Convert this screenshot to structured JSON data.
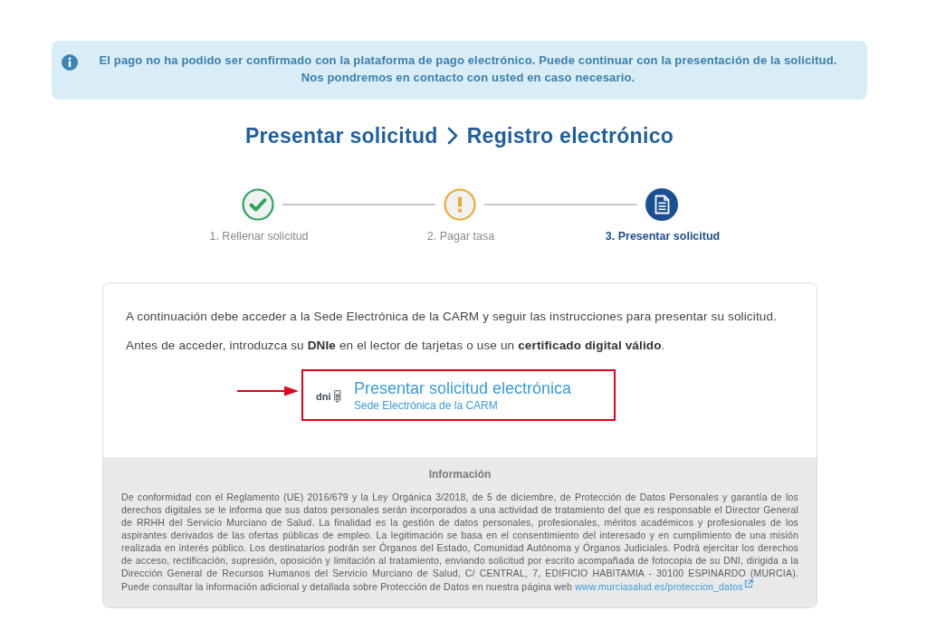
{
  "alert": {
    "lines": [
      "El pago no ha podido ser confirmado con la plataforma de pago electrónico. Puede continuar con la presentación de la solicitud.",
      "Nos pondremos en contacto con usted en caso necesario."
    ]
  },
  "breadcrumb": [
    {
      "label": "Presentar solicitud"
    },
    {
      "label": "Registro electrónico"
    }
  ],
  "steps": [
    {
      "label": "1. Rellenar solicitud",
      "kind": "done",
      "selected": false
    },
    {
      "label": "2. Pagar tasa",
      "kind": "warning",
      "selected": false
    },
    {
      "label": "3. Presentar solicitud",
      "kind": "document",
      "selected": true
    }
  ],
  "instructions": {
    "intro": "A continuación debe acceder a la Sede Electrónica de la CARM y seguir las instrucciones para presentar su solicitud.",
    "notice": "Antes de acceder, introduzca su **DNIe** en el lector de tarjetas o use un **certificado digital válido**."
  },
  "access_link": {
    "logo_text": "dni",
    "title": "Presentar solicitud electrónica",
    "subtitle": "Sede Electrónica de la CARM",
    "highlighted": true
  },
  "information": {
    "title": "Información",
    "text": "De conformidad con el Reglamento (UE) 2016/679 y la Ley Orgánica 3/2018, de 5 de diciembre, de Protección de Datos Personales y garantía de los derechos digitales se le informa que sus datos personales serán incorporados a una actividad de tratamiento del que es responsable el Director General de RRHH del Servicio Murciano de Salud. La finalidad es la gestión de datos personales, profesionales, méritos académicos y profesionales de los aspirantes derivados de las ofertas públicas de empleo. La legitimación se basa en el consentimiento del interesado y en cumplimiento de una misión realizada en interés público. Los destinatarios podrán ser Órganos del Estado, Comunidad Autónoma y Órganos Judiciales. Podrá ejercitar los derechos de acceso, rectificación, supresión, oposición y limitación al tratamiento, enviando solicitud por escrito acompañada de fotocopia de su DNI, dirigida a la Dirección General de Recursos Humanos del Servicio Murciano de Salud, C/ CENTRAL, 7, EDIFICIO HABITAMIA - 30100 ESPINARDO (MURCIA). Puede consultar la información adicional y detallada sobre Protección de Datos en nuestra página web ",
    "link": "www.murciasalud.es/proteccion_datos"
  }
}
